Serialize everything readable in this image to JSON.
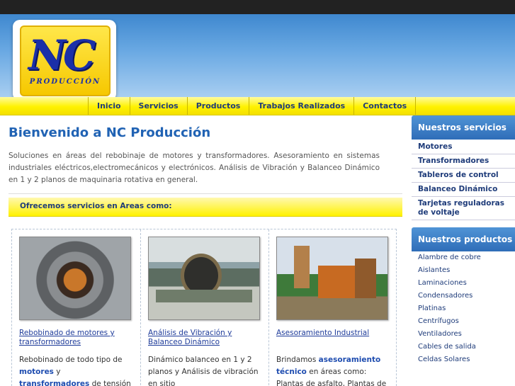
{
  "logo": {
    "text": "NC",
    "subtext": "PRODUCCIÓN"
  },
  "nav": [
    "Inicio",
    "Servicios",
    "Productos",
    "Trabajos Realizados",
    "Contactos"
  ],
  "main": {
    "title": "Bienvenido a NC Producción",
    "intro": "Soluciones en áreas del rebobinaje de motores y transformadores. Asesoramiento en sistemas industriales eléctricos,electromecánicos y electrónicos. Análisis de Vibración y Balanceo Dinámico en 1 y 2 planos de maquinaria rotativa en general.",
    "offer_title": "Ofrecemos servicios en Areas como:"
  },
  "cards": [
    {
      "title": "Rebobinado de motores y transformadores",
      "text_before": "Rebobinado de todo tipo de ",
      "bold1": "motores",
      "text_mid": " y ",
      "bold2": "transformadores",
      "text_after": " de tensión media y tensión"
    },
    {
      "title": "Análisis de Vibración y Balanceo Dinámico",
      "text": "Dinámico balanceo en 1 y 2 planos y Análisis de vibración en sitio"
    },
    {
      "title": "Asesoramiento Industrial",
      "text_before": "Brindamos ",
      "bold1": "asesoramiento técnico",
      "text_after": " en áreas como: Plantas de asfalto, Plantas de suelo cemento, etc."
    }
  ],
  "sidebar": {
    "services_title": "Nuestros servicios",
    "services": [
      "Motores",
      "Transformadores",
      "Tableros de control",
      "Balanceo Dinámico",
      "Tarjetas reguladoras de voltaje"
    ],
    "products_title": "Nuestros productos",
    "products": [
      "Alambre de cobre",
      "Aislantes",
      "Laminaciones",
      "Condensadores",
      "Platinas",
      "Centrífugos",
      "Ventiladores",
      "Cables de salida",
      "Celdas Solares"
    ]
  }
}
